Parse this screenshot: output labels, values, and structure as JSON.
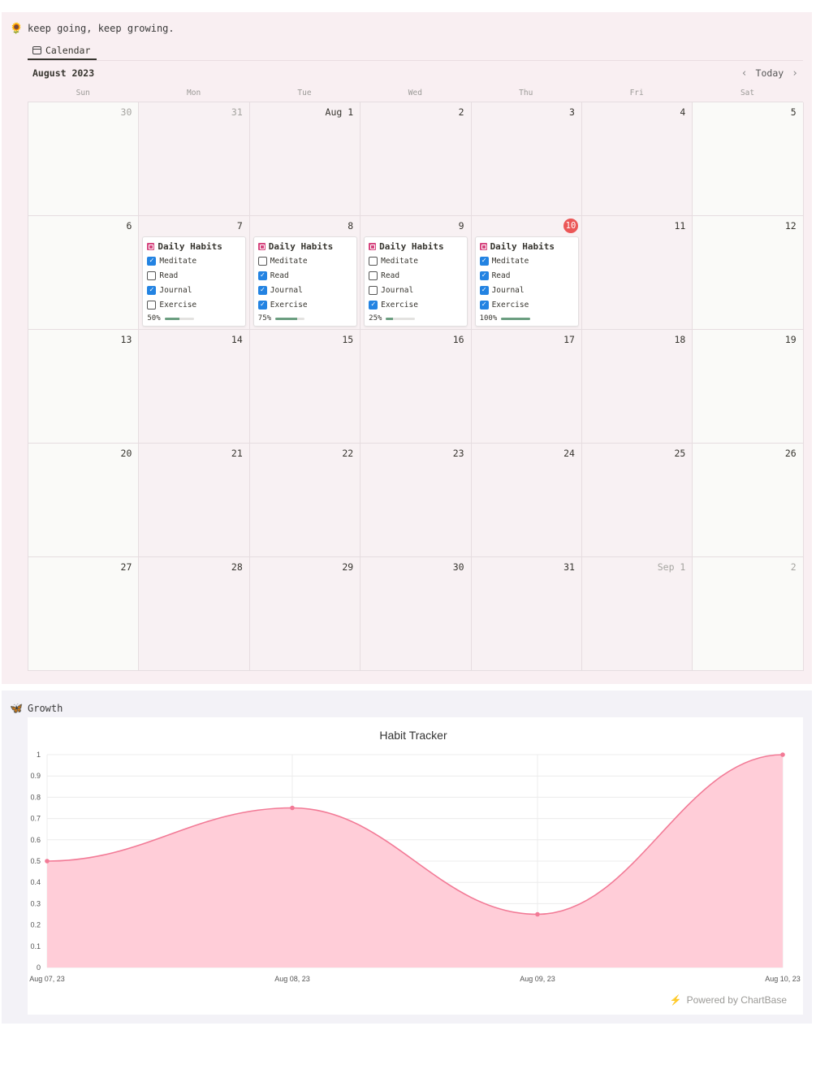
{
  "header": {
    "emoji": "🌻",
    "quote": "keep going, keep growing."
  },
  "tab": {
    "label": "Calendar"
  },
  "calendar": {
    "month_label": "August 2023",
    "today_label": "Today",
    "weekdays": [
      "Sun",
      "Mon",
      "Tue",
      "Wed",
      "Thu",
      "Fri",
      "Sat"
    ],
    "days": [
      {
        "label": "30",
        "muted": true
      },
      {
        "label": "31",
        "muted": true
      },
      {
        "label": "Aug 1"
      },
      {
        "label": "2"
      },
      {
        "label": "3"
      },
      {
        "label": "4"
      },
      {
        "label": "5"
      },
      {
        "label": "6"
      },
      {
        "label": "7"
      },
      {
        "label": "8"
      },
      {
        "label": "9"
      },
      {
        "label": "10",
        "today": true
      },
      {
        "label": "11"
      },
      {
        "label": "12"
      },
      {
        "label": "13"
      },
      {
        "label": "14"
      },
      {
        "label": "15"
      },
      {
        "label": "16"
      },
      {
        "label": "17"
      },
      {
        "label": "18"
      },
      {
        "label": "19"
      },
      {
        "label": "20"
      },
      {
        "label": "21"
      },
      {
        "label": "22"
      },
      {
        "label": "23"
      },
      {
        "label": "24"
      },
      {
        "label": "25"
      },
      {
        "label": "26"
      },
      {
        "label": "27"
      },
      {
        "label": "28"
      },
      {
        "label": "29"
      },
      {
        "label": "30"
      },
      {
        "label": "31"
      },
      {
        "label": "Sep 1",
        "muted": true
      },
      {
        "label": "2",
        "muted": true
      }
    ],
    "entries": [
      {
        "day_index": 8,
        "title": "Daily Habits",
        "habits": [
          {
            "name": "Meditate",
            "checked": true
          },
          {
            "name": "Read",
            "checked": false
          },
          {
            "name": "Journal",
            "checked": true
          },
          {
            "name": "Exercise",
            "checked": false
          }
        ],
        "progress_label": "50%",
        "progress": 0.5
      },
      {
        "day_index": 9,
        "title": "Daily Habits",
        "habits": [
          {
            "name": "Meditate",
            "checked": false
          },
          {
            "name": "Read",
            "checked": true
          },
          {
            "name": "Journal",
            "checked": true
          },
          {
            "name": "Exercise",
            "checked": true
          }
        ],
        "progress_label": "75%",
        "progress": 0.75
      },
      {
        "day_index": 10,
        "title": "Daily Habits",
        "habits": [
          {
            "name": "Meditate",
            "checked": false
          },
          {
            "name": "Read",
            "checked": false
          },
          {
            "name": "Journal",
            "checked": false
          },
          {
            "name": "Exercise",
            "checked": true
          }
        ],
        "progress_label": "25%",
        "progress": 0.25
      },
      {
        "day_index": 11,
        "title": "Daily Habits",
        "habits": [
          {
            "name": "Meditate",
            "checked": true
          },
          {
            "name": "Read",
            "checked": true
          },
          {
            "name": "Journal",
            "checked": true
          },
          {
            "name": "Exercise",
            "checked": true
          }
        ],
        "progress_label": "100%",
        "progress": 1.0
      }
    ]
  },
  "growth": {
    "emoji": "🦋",
    "label": "Growth",
    "powered_by": "Powered by ChartBase"
  },
  "colors": {
    "line": "#f27a96",
    "fill": "#ffcdd8",
    "today": "#eb5757",
    "checkbox": "#2383e2",
    "progress": "#6b9e80"
  },
  "chart_data": {
    "type": "area",
    "title": "Habit Tracker",
    "x": [
      "Aug 07, 23",
      "Aug 08, 23",
      "Aug 09, 23",
      "Aug 10, 23"
    ],
    "values": [
      0.5,
      0.75,
      0.25,
      1
    ],
    "ylim": [
      0,
      1
    ],
    "yticks": [
      "0",
      "0.1",
      "0.2",
      "0.3",
      "0.4",
      "0.5",
      "0.6",
      "0.7",
      "0.8",
      "0.9",
      "1"
    ],
    "grid": true,
    "legend": "none"
  }
}
